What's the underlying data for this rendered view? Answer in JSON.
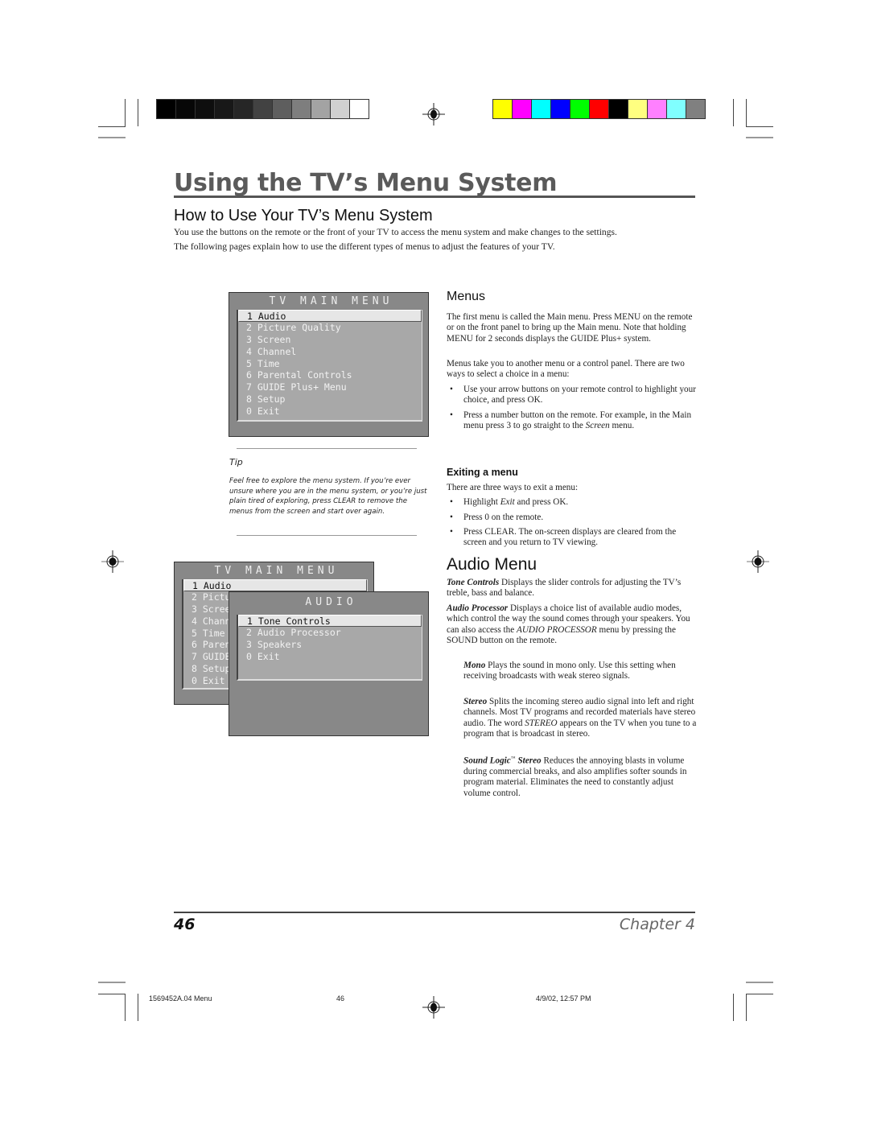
{
  "print_marks": {
    "gray_swatches": [
      "#000000",
      "#070707",
      "#0e0e0e",
      "#181818",
      "#262626",
      "#424242",
      "#5e5e5e",
      "#7e7e7e",
      "#a3a3a3",
      "#d0d0d0",
      "#ffffff"
    ],
    "color_swatches": [
      "#ffff00",
      "#ff00ff",
      "#00ffff",
      "#0000ff",
      "#00ff00",
      "#ff0000",
      "#000000",
      "#ffff80",
      "#ff80ff",
      "#80ffff",
      "#808080"
    ]
  },
  "header": {
    "title": "Using the TV’s Menu System",
    "subtitle": "How to Use Your TV’s Menu System",
    "intro_lines": [
      "You use the buttons on the remote or the front of your TV to access the menu system and make changes to the settings.",
      "The following pages explain how to use the different types of menus to adjust the features of your TV."
    ]
  },
  "main_menu_1": {
    "title": "TV MAIN MENU",
    "items": [
      "1 Audio",
      "2 Picture Quality",
      "3 Screen",
      "4 Channel",
      "5 Time",
      "6 Parental Controls",
      "7 GUIDE Plus+ Menu",
      "8 Setup",
      "0 Exit"
    ],
    "selected_index": 0
  },
  "tip": {
    "label": "Tip",
    "text": "Feel free to explore the menu system. If you’re ever unsure where you are in the menu system, or you’re just plain tired of exploring, press CLEAR to remove the menus from the screen and start over again."
  },
  "main_menu_2": {
    "title": "TV MAIN MENU",
    "items": [
      "1 Audio",
      "2 Pictu",
      "3 Scree",
      "4 Chann",
      "5 Time",
      "6 Paren",
      "7 GUIDE",
      "8 Setup",
      "0 Exit"
    ],
    "selected_index": 0
  },
  "audio_menu": {
    "title": "AUDIO",
    "items": [
      "1 Tone Controls",
      "2 Audio Processor",
      "3 Speakers",
      "0 Exit"
    ],
    "selected_index": 0
  },
  "menus_section": {
    "heading": "Menus",
    "para1": "The first menu is called the Main menu. Press MENU on the remote or on the front panel to bring up the Main menu. Note that holding MENU for 2 seconds displays the GUIDE Plus+ system.",
    "para2": "Menus take you to another menu or a control panel. There are two ways to select a choice in a menu:",
    "bullets": [
      "Use your arrow buttons on your remote control to highlight your choice, and press OK.",
      "Press a number button on the remote. For example, in the Main menu press 3 to go straight to the "
    ],
    "bullet2_italic": "Screen",
    "bullet2_end": " menu."
  },
  "exiting_section": {
    "heading": "Exiting a menu",
    "intro": "There are three ways to exit a menu:",
    "bullet1_pre": "Highlight ",
    "bullet1_italic": "Exit",
    "bullet1_post": " and press OK.",
    "bullet2": "Press 0 on the remote.",
    "bullet3": "Press CLEAR. The on-screen displays are cleared from the screen and you return to TV viewing."
  },
  "audio_section": {
    "heading": "Audio Menu",
    "tone_term": "Tone Controls",
    "tone_desc": "  Displays the slider controls for adjusting the TV’s treble, bass and balance.",
    "proc_term": "Audio Processor",
    "proc_desc1": "  Displays a choice list of available audio modes, which control the way the sound comes through your speakers. You can also access the ",
    "proc_italic": "AUDIO PROCESSOR",
    "proc_desc2": " menu by pressing the SOUND button on the remote.",
    "mono_term": "Mono",
    "mono_desc": "   Plays the sound in mono only. Use this setting when receiving broadcasts with weak stereo signals.",
    "stereo_term": "Stereo",
    "stereo_desc1": "   Splits the incoming stereo audio signal into left and right channels. Most TV programs and recorded materials have stereo audio. The word ",
    "stereo_italic": "STEREO",
    "stereo_desc2": " appears on the TV when you tune to a program that is broadcast in stereo.",
    "sl_term": "Sound Logic",
    "sl_tm": "™",
    "sl_term2": " Stereo",
    "sl_desc": "    Reduces the annoying blasts in volume during commercial breaks, and also amplifies softer sounds in program material. Eliminates the need to constantly adjust volume control."
  },
  "footer": {
    "page_number": "46",
    "chapter": "Chapter 4"
  },
  "slug": {
    "file": "1569452A.04 Menu",
    "page": "46",
    "date": "4/9/02, 12:57 PM"
  }
}
